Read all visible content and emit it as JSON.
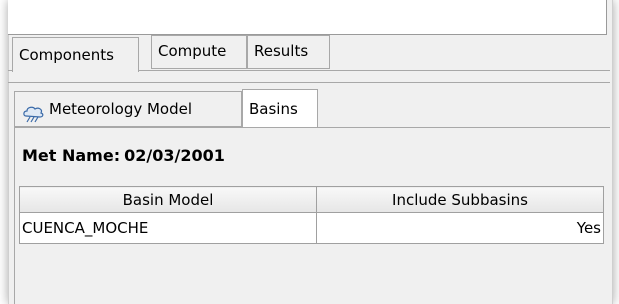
{
  "outer_tabs": [
    {
      "label": "Components",
      "selected": true
    },
    {
      "label": "Compute",
      "selected": false
    },
    {
      "label": "Results",
      "selected": false
    }
  ],
  "inner_tabs": [
    {
      "label": "Meteorology Model",
      "icon": "meteorology-icon",
      "selected": false
    },
    {
      "label": "Basins",
      "selected": true
    }
  ],
  "met_name": {
    "label": "Met Name:",
    "value": "02/03/2001"
  },
  "table": {
    "headers": [
      "Basin Model",
      "Include Subbasins"
    ],
    "rows": [
      {
        "basin_model": "CUENCA_MOCHE",
        "include_subbasins": "Yes"
      }
    ]
  }
}
